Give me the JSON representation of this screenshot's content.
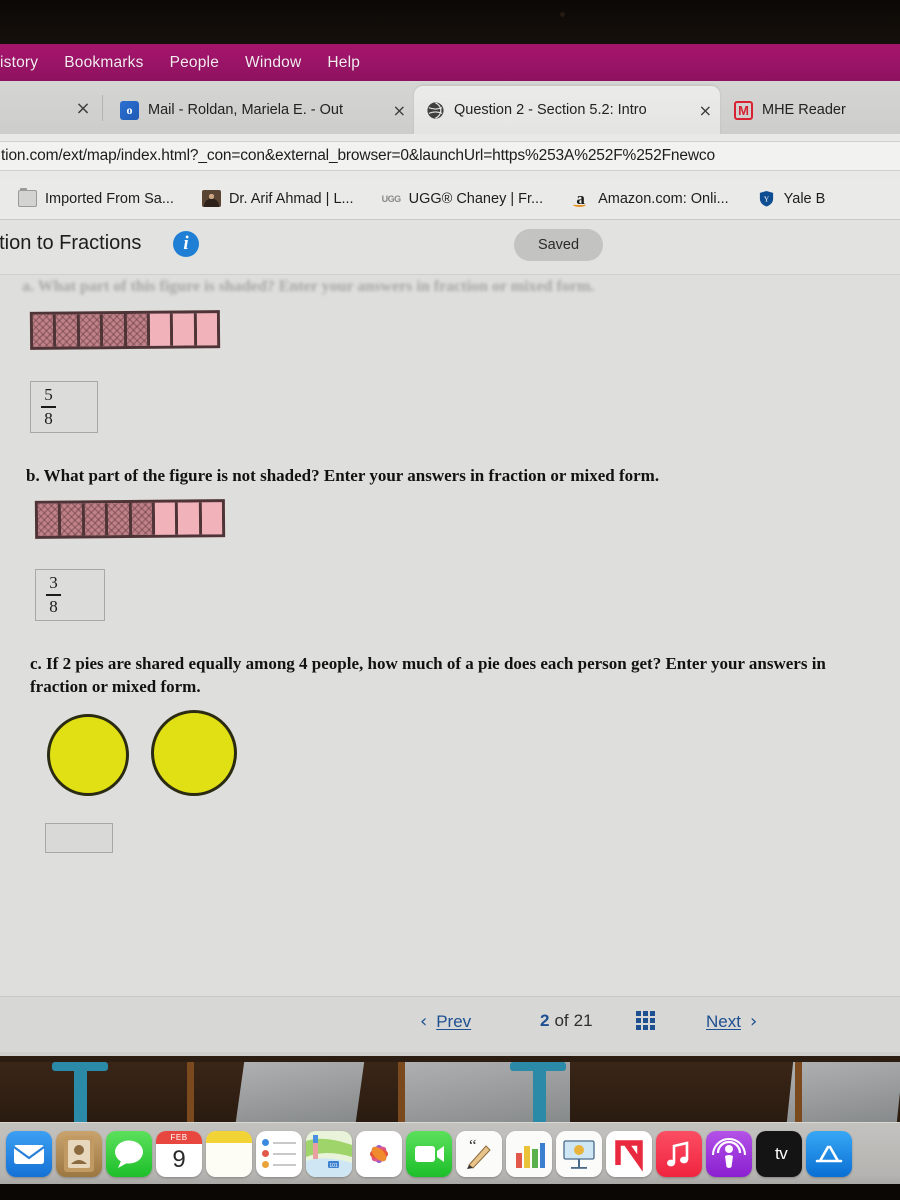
{
  "menubar": {
    "items": [
      {
        "name": "history",
        "label": "istory"
      },
      {
        "name": "bookmarks",
        "label": "Bookmarks"
      },
      {
        "name": "people",
        "label": "People"
      },
      {
        "name": "window",
        "label": "Window"
      },
      {
        "name": "help",
        "label": "Help"
      }
    ],
    "bg_color": "#9e1468"
  },
  "browser": {
    "tabs": [
      {
        "name": "mail",
        "title": "Mail - Roldan, Mariela E. - Out",
        "favicon": "outlook-icon",
        "close": "×",
        "active": false
      },
      {
        "name": "question",
        "title": "Question 2 - Section 5.2: Intro",
        "favicon": "globe-icon",
        "close": "×",
        "active": true
      },
      {
        "name": "mhe-reader",
        "title": "MHE Reader",
        "favicon": "mhe-m-icon",
        "badge": "M",
        "active": false
      }
    ],
    "tab_close_left": "×",
    "url": "tion.com/ext/map/index.html?_con=con&external_browser=0&launchUrl=https%253A%252F%252Fnewco",
    "bookmarks": [
      {
        "name": "imported-from-safari",
        "label": "Imported From Sa...",
        "icon": "folder-icon"
      },
      {
        "name": "dr-arif-ahmad",
        "label": "Dr. Arif Ahmad | L...",
        "icon": "avatar-icon"
      },
      {
        "name": "ugg-chaney",
        "label": "UGG® Chaney | Fr...",
        "icon": "ugg-icon"
      },
      {
        "name": "amazon",
        "label": "Amazon.com: Onli...",
        "icon": "amazon-icon"
      },
      {
        "name": "yale",
        "label": "Yale B",
        "icon": "yale-shield-icon"
      }
    ]
  },
  "assignment": {
    "title": "uction to Fractions",
    "info_icon": "i",
    "status": "Saved"
  },
  "question": {
    "part_a_text": "a. What part of this figure is shaded? Enter your answers in fraction or mixed form.",
    "part_b_text": "b. What part of the figure is not shaded? Enter your answers in fraction or mixed form.",
    "part_c_text": "c. If 2 pies are shared equally among 4 people, how much of a pie does each person get? Enter your answers in fraction or mixed form.",
    "figure_a": {
      "total_cells": 8,
      "shaded_cells": 5,
      "shaded_color": "#c08189",
      "unshaded_color": "#f2b2ba",
      "border_color": "#4e3436"
    },
    "figure_b": {
      "total_cells": 8,
      "shaded_cells": 5,
      "shaded_color": "#c08189",
      "unshaded_color": "#f2b2ba",
      "border_color": "#4e3436"
    },
    "answer_a": {
      "numerator": "5",
      "denominator": "8"
    },
    "answer_b": {
      "numerator": "3",
      "denominator": "8"
    },
    "answer_c": {
      "value": "",
      "placeholder": ""
    },
    "pies": {
      "count": 2,
      "fill_color": "#e0e015",
      "border_color": "#2b2b12"
    }
  },
  "nav": {
    "prev_label": "Prev",
    "prev_chevron": "‹",
    "current_page": "2",
    "of_label": "of",
    "total_pages": "21",
    "grid_icon": "grid-icon",
    "next_label": "Next",
    "next_chevron": "›",
    "accent_color": "#1d4f91"
  },
  "dock": {
    "items": [
      {
        "name": "mail",
        "label": "Mail",
        "glyph": "✉",
        "running": false
      },
      {
        "name": "contacts",
        "label": "Contacts",
        "glyph": "◎",
        "running": false
      },
      {
        "name": "messages",
        "label": "Messages",
        "glyph": "●",
        "running": false
      },
      {
        "name": "calendar",
        "label": "Calendar",
        "month": "FEB",
        "day": "9",
        "running": true
      },
      {
        "name": "notes",
        "label": "Notes",
        "running": false
      },
      {
        "name": "reminders",
        "label": "Reminders",
        "running": false
      },
      {
        "name": "maps",
        "label": "Maps",
        "running": true
      },
      {
        "name": "photos",
        "label": "Photos",
        "running": false
      },
      {
        "name": "facetime",
        "label": "FaceTime",
        "running": false
      },
      {
        "name": "pages",
        "label": "Pages",
        "running": false
      },
      {
        "name": "numbers",
        "label": "Numbers",
        "running": false
      },
      {
        "name": "keynote",
        "label": "Keynote",
        "running": false
      },
      {
        "name": "news",
        "label": "News",
        "running": false
      },
      {
        "name": "music",
        "label": "Music",
        "glyph": "♫",
        "running": false
      },
      {
        "name": "podcasts",
        "label": "Podcasts",
        "running": true
      },
      {
        "name": "appletv",
        "label": "Apple TV",
        "glyph": " tv",
        "running": true
      },
      {
        "name": "appstore",
        "label": "App Store",
        "glyph": "A",
        "running": false
      }
    ]
  }
}
